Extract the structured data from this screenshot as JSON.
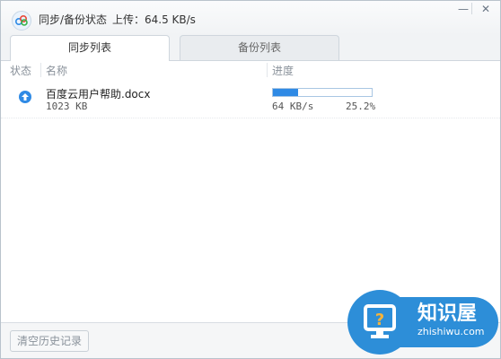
{
  "window": {
    "title": "同步/备份状态",
    "speed": "上传：64.5 KB/s",
    "minimize_glyph": "—",
    "close_glyph": "✕"
  },
  "tabs": [
    {
      "label": "同步列表",
      "selected": true
    },
    {
      "label": "备份列表",
      "selected": false
    }
  ],
  "table": {
    "headers": {
      "status": "状态",
      "name": "名称",
      "progress": "进度"
    },
    "rows": [
      {
        "status_icon": "upload-arrow-icon",
        "name": "百度云用户帮助.docx",
        "size": "1023 KB",
        "rate": "64 KB/s",
        "percent": "25.2%",
        "progress_fraction": 0.252
      }
    ]
  },
  "footer": {
    "clear_button": "清空历史记录"
  },
  "watermark": {
    "text": "知识屋",
    "url": "zhishiwu.com",
    "brand_color": "#2d8ed8"
  },
  "colors": {
    "accent": "#2f8ae5",
    "border": "#cfd6dd"
  }
}
